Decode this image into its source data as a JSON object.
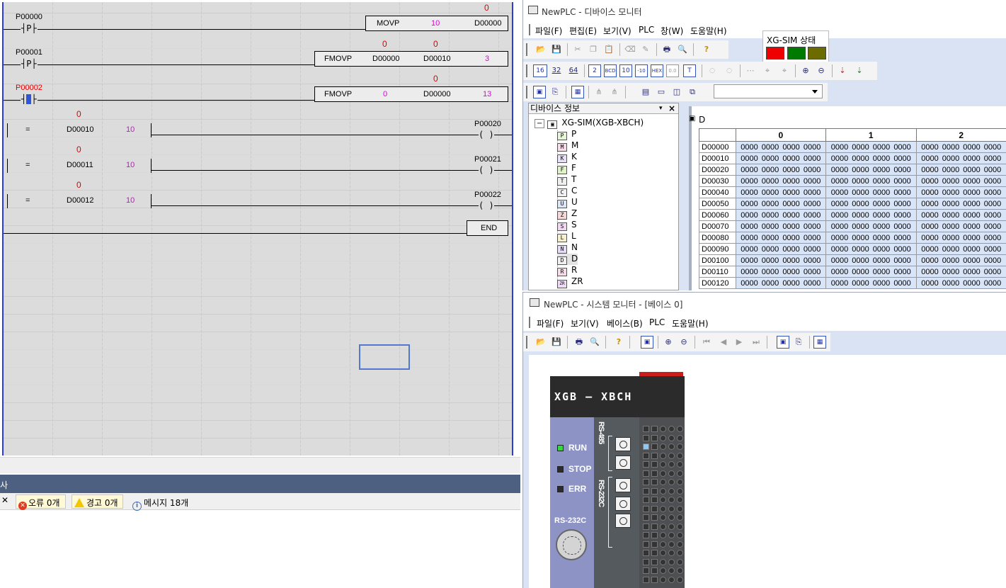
{
  "ladder": {
    "rung1": {
      "contact_label": "P00000",
      "contact_symbol": "P",
      "box": {
        "instr": "MOVP",
        "src": "10",
        "dst": "D00000",
        "dst_value": "0"
      }
    },
    "rung2": {
      "contact_label": "P00001",
      "contact_symbol": "P",
      "box": {
        "instr": "FMOVP",
        "src": "D00000",
        "dst": "D00010",
        "count": "3",
        "src_value": "0",
        "dst_value": "0"
      }
    },
    "rung3": {
      "contact_label": "P00002",
      "contact_symbol": "P",
      "box": {
        "instr": "FMOVP",
        "src": "0",
        "dst": "D00000",
        "count": "13",
        "dst_value": "0"
      }
    },
    "rung4": {
      "cmp": "=",
      "operand": "D00010",
      "operand_value": "0",
      "constant": "10",
      "coil": "P00020",
      "coil_symbol": "( )"
    },
    "rung5": {
      "cmp": "=",
      "operand": "D00011",
      "operand_value": "0",
      "constant": "10",
      "coil": "P00021",
      "coil_symbol": "( )"
    },
    "rung6": {
      "cmp": "=",
      "operand": "D00012",
      "operand_value": "0",
      "constant": "10",
      "coil": "P00022",
      "coil_symbol": "( )"
    },
    "end_label": "END"
  },
  "messages": {
    "header": "사",
    "errors": "오류 0개",
    "warnings": "경고 0개",
    "info": "메시지 18개"
  },
  "device_monitor": {
    "title": "NewPLC - 디바이스 모니터",
    "menu": [
      "파일(F)",
      "편집(E)",
      "보기(V)",
      "PLC",
      "창(W)",
      "도움말(H)"
    ],
    "toolbar2": [
      "16",
      "32",
      "64",
      "2",
      "BCD",
      "10",
      "-10",
      "HEX",
      "0.0",
      "T"
    ],
    "xgsim_status_title": "XG-SIM 상태",
    "status_colors": [
      "#ee0000",
      "#007a00",
      "#6b6b00"
    ],
    "combo_value": "",
    "device_info_title": "디바이스 정보",
    "tree_root": "XG-SIM(XGB-XBCH)",
    "tree_items": [
      "P",
      "M",
      "K",
      "F",
      "T",
      "C",
      "U",
      "Z",
      "S",
      "L",
      "N",
      "D",
      "R",
      "ZR"
    ],
    "panel_title": "D",
    "columns": [
      "0",
      "1",
      "2"
    ],
    "rows": [
      {
        "addr": "D00000",
        "cells": [
          "0000  0000  0000  0000",
          "0000  0000  0000  0000",
          "0000  0000  0000  0000"
        ]
      },
      {
        "addr": "D00010",
        "cells": [
          "0000  0000  0000  0000",
          "0000  0000  0000  0000",
          "0000  0000  0000  0000"
        ]
      },
      {
        "addr": "D00020",
        "cells": [
          "0000  0000  0000  0000",
          "0000  0000  0000  0000",
          "0000  0000  0000  0000"
        ]
      },
      {
        "addr": "D00030",
        "cells": [
          "0000  0000  0000  0000",
          "0000  0000  0000  0000",
          "0000  0000  0000  0000"
        ]
      },
      {
        "addr": "D00040",
        "cells": [
          "0000  0000  0000  0000",
          "0000  0000  0000  0000",
          "0000  0000  0000  0000"
        ]
      },
      {
        "addr": "D00050",
        "cells": [
          "0000  0000  0000  0000",
          "0000  0000  0000  0000",
          "0000  0000  0000  0000"
        ]
      },
      {
        "addr": "D00060",
        "cells": [
          "0000  0000  0000  0000",
          "0000  0000  0000  0000",
          "0000  0000  0000  0000"
        ]
      },
      {
        "addr": "D00070",
        "cells": [
          "0000  0000  0000  0000",
          "0000  0000  0000  0000",
          "0000  0000  0000  0000"
        ]
      },
      {
        "addr": "D00080",
        "cells": [
          "0000  0000  0000  0000",
          "0000  0000  0000  0000",
          "0000  0000  0000  0000"
        ]
      },
      {
        "addr": "D00090",
        "cells": [
          "0000  0000  0000  0000",
          "0000  0000  0000  0000",
          "0000  0000  0000  0000"
        ]
      },
      {
        "addr": "D00100",
        "cells": [
          "0000  0000  0000  0000",
          "0000  0000  0000  0000",
          "0000  0000  0000  0000"
        ]
      },
      {
        "addr": "D00110",
        "cells": [
          "0000  0000  0000  0000",
          "0000  0000  0000  0000",
          "0000  0000  0000  0000"
        ]
      },
      {
        "addr": "D00120",
        "cells": [
          "0000  0000  0000  0000",
          "0000  0000  0000  0000",
          "0000  0000  0000  0000"
        ]
      }
    ]
  },
  "system_monitor": {
    "title": "NewPLC - 시스템 모니터 - [베이스 0]",
    "menu": [
      "파일(F)",
      "보기(V)",
      "베이스(B)",
      "PLC",
      "도움말(H)"
    ],
    "plc": {
      "brand": "XGB — XBCH",
      "led_run": "RUN",
      "led_stop": "STOP",
      "led_err": "ERR",
      "rs485": "RS-485",
      "rs232c_v": "RS-232C",
      "rs232c_port": "RS-232C",
      "run_led_color": "#2edc3a"
    }
  }
}
